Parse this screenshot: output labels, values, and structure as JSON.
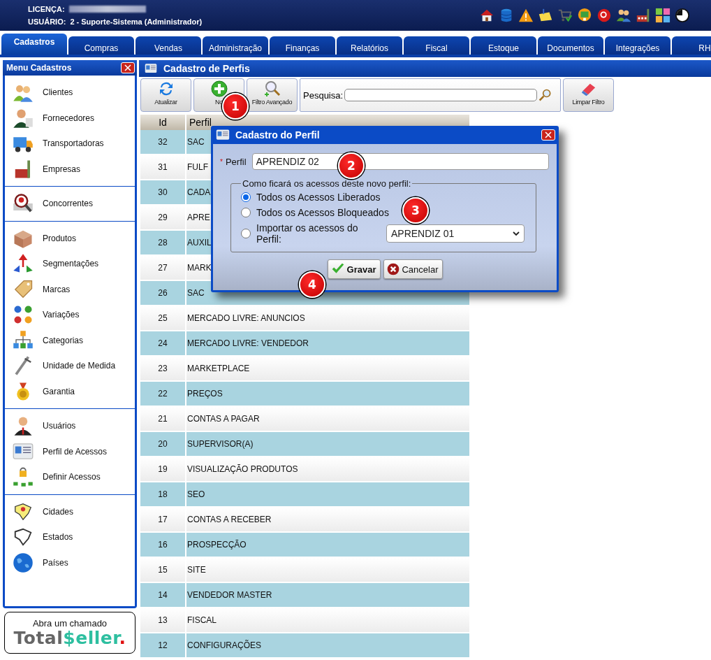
{
  "header": {
    "license_label": "LICENÇA:",
    "user_label": "USUÁRIO:",
    "user_value": "2 - Suporte-Sistema (Administrador)"
  },
  "tabs": [
    {
      "label": "Cadastros",
      "selected": true
    },
    {
      "label": "Compras",
      "selected": false
    },
    {
      "label": "Vendas",
      "selected": false
    },
    {
      "label": "Administração",
      "selected": false
    },
    {
      "label": "Finanças",
      "selected": false
    },
    {
      "label": "Relatórios",
      "selected": false
    },
    {
      "label": "Fiscal",
      "selected": false
    },
    {
      "label": "Estoque",
      "selected": false
    },
    {
      "label": "Documentos",
      "selected": false
    },
    {
      "label": "Integrações",
      "selected": false
    },
    {
      "label": "RH",
      "selected": false
    }
  ],
  "sidebar": {
    "title": "Menu Cadastros",
    "groups": [
      {
        "items": [
          "Clientes",
          "Fornecedores",
          "Transportadoras",
          "Empresas"
        ]
      },
      {
        "items": [
          "Concorrentes"
        ]
      },
      {
        "items": [
          "Produtos",
          "Segmentações",
          "Marcas",
          "Variações",
          "Categorias",
          "Unidade de Medida",
          "Garantia"
        ]
      },
      {
        "items": [
          "Usuários",
          "Perfil de Acessos",
          "Definir Acessos"
        ]
      },
      {
        "items": [
          "Cidades",
          "Estados",
          "Países"
        ]
      }
    ]
  },
  "help_box": {
    "text": "Abra um chamado",
    "logo_first": "Total",
    "logo_second": "$eller",
    "logo_dot": "."
  },
  "panel": {
    "title": "Cadastro de Perfis",
    "toolbar": [
      "Atualizar",
      "No",
      "Filtro Avançado"
    ],
    "search": {
      "label": "Pesquisa:"
    },
    "clear_button": "Limpar Filtro",
    "table": {
      "columns": [
        "Id",
        "Perfil"
      ],
      "rows": [
        [
          "32",
          "SAC"
        ],
        [
          "31",
          "FULF"
        ],
        [
          "30",
          "CADA"
        ],
        [
          "29",
          "APRE"
        ],
        [
          "28",
          "AUXIL"
        ],
        [
          "27",
          "MARK"
        ],
        [
          "26",
          "SAC"
        ],
        [
          "25",
          "MERCADO LIVRE: ANUNCIOS"
        ],
        [
          "24",
          "MERCADO LIVRE: VENDEDOR"
        ],
        [
          "23",
          "MARKETPLACE"
        ],
        [
          "22",
          "PREÇOS"
        ],
        [
          "21",
          "CONTAS A PAGAR"
        ],
        [
          "20",
          "SUPERVISOR(A)"
        ],
        [
          "19",
          "VISUALIZAÇÃO PRODUTOS"
        ],
        [
          "18",
          "SEO"
        ],
        [
          "17",
          "CONTAS A RECEBER"
        ],
        [
          "16",
          "PROSPECÇÃO"
        ],
        [
          "15",
          "SITE"
        ],
        [
          "14",
          "VENDEDOR MASTER"
        ],
        [
          "13",
          "FISCAL"
        ],
        [
          "12",
          "CONFIGURAÇÕES"
        ]
      ]
    }
  },
  "dialog": {
    "title": "Cadastro do Perfil",
    "required_mark": "*",
    "field_label": "Perfil",
    "field_value": "APRENDIZ 02",
    "legend": "Como ficará os acessos deste novo perfil:",
    "options": [
      {
        "label": "Todos os Acessos Liberados",
        "selected": true
      },
      {
        "label": "Todos os Acessos Bloqueados",
        "selected": false
      },
      {
        "label": "Importar os acessos do Perfil:",
        "selected": false
      }
    ],
    "import_value": "APRENDIZ 01",
    "buttons": [
      "Gravar",
      "Cancelar"
    ]
  },
  "markers": [
    "1",
    "2",
    "3",
    "4"
  ]
}
